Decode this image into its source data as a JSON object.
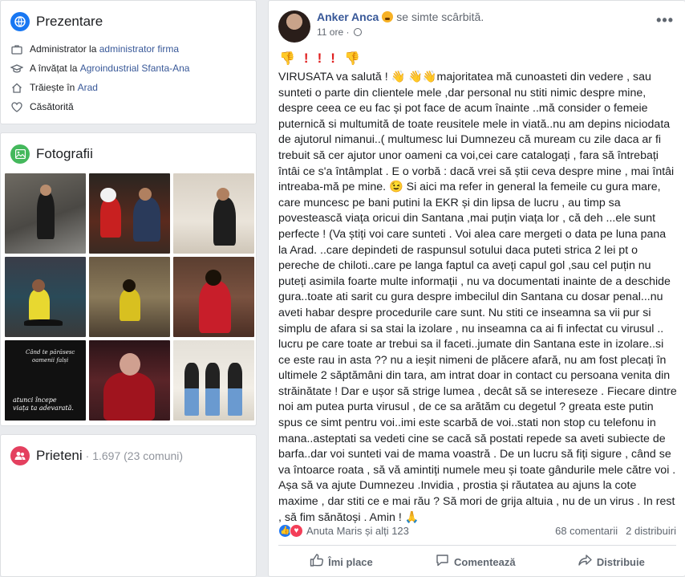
{
  "intro": {
    "title": "Prezentare",
    "items": [
      {
        "icon": "briefcase-icon",
        "prefix": "Administrator la",
        "link": "administrator firma"
      },
      {
        "icon": "graduation-cap-icon",
        "prefix": "A învățat la",
        "link": "Agroindustrial Sfanta-Ana"
      },
      {
        "icon": "home-icon",
        "prefix": "Trăiește în",
        "link": "Arad"
      },
      {
        "icon": "heart-icon",
        "prefix": "Căsătorită",
        "link": ""
      }
    ]
  },
  "photos": {
    "title": "Fotografii",
    "quote_lines": [
      "Când te părăsesc",
      "oamenii falși"
    ],
    "quote_bottom": [
      "atunci începe",
      "viața ta adevarată."
    ]
  },
  "friends": {
    "title": "Prieteni",
    "count": "· 1.697 (23 comuni)"
  },
  "post": {
    "author": "Anker Anca",
    "feeling": "se simte scârbită.",
    "time": "11 ore ·",
    "emoji_row": [
      "👎",
      "!",
      "!",
      "!",
      "👎"
    ],
    "body": "VIRUSATA va salută ! 👋 👋👋majoritatea mă cunoasteti din vedere , sau sunteti o parte din clientele mele ,dar personal nu stiti nimic despre mine, despre ceea ce eu fac și pot face de acum înainte ..mă consider o femeie puternică si multumită de toate reusitele mele in viată..nu am depins niciodata de ajutorul nimanui..( multumesc lui Dumnezeu că muream cu zile daca ar fi trebuit să cer ajutor unor oameni ca voi,cei care catalogați , fara să întrebați întâi ce s'a întâmplat . E o vorbă : dacă vrei să știi ceva despre mine , mai întâi intreaba-mă pe mine. 😉 Si aici ma refer in general la femeile cu gura mare, care muncesc pe bani putini la EKR și din lipsa de lucru , au timp sa povestească viața oricui din Santana ,mai puțin viața lor , că deh ...ele sunt perfecte ! (Va știți voi care sunteti . Voi alea care mergeti o data pe luna pana la Arad. ..care depindeti de raspunsul sotului daca puteti strica 2 lei pt o pereche de chiloti..care pe langa faptul ca aveți capul gol ,sau cel puțin nu puteți asimila foarte multe informații , nu va documentati inainte de a deschide gura..toate ati sarit cu gura despre imbecilul din Santana cu dosar penal...nu aveti habar despre procedurile care sunt. Nu stiti ce inseamna sa vii pur si simplu de afara si sa stai la izolare , nu inseamna ca ai fi infectat cu virusul .. lucru pe care toate ar trebui sa il faceti..jumate din Santana este in izolare..si ce este rau in asta ?? nu a ieșit nimeni de plăcere afară, nu am fost plecați în ultimele 2 săptămâni din tara, am intrat doar in contact cu persoana venita din străinătate ! Dar e ușor să strige lumea , decât să se intereseze . Fiecare dintre noi am putea purta virusul , de ce sa arătăm cu degetul ? greata este putin spus ce simt pentru voi..imi este scarbă de voi..stati non stop cu telefonu in mana..asteptati sa vedeti cine se cacă să postati repede sa aveti subiecte de barfa..dar voi sunteti vai de mama voastră . De un lucru să fiți sigure , când se va întoarce roata , să vă amintiți numele meu și toate gândurile mele către voi . Așa să va ajute Dumnezeu .Invidia , prostia și răutatea au ajuns la cote maxime , dar stiti ce e mai rău ? Să mori de grija altuia , nu de un virus . In rest , să fim sănătoși . Amin ! 🙏",
    "reactions_text": "Anuta Maris și alți 123",
    "comments": "68 comentarii",
    "shares": "2 distribuiri",
    "actions": {
      "like": "Îmi place",
      "comment": "Comentează",
      "share": "Distribuie"
    }
  },
  "colors": {
    "link": "#385898",
    "intro_icon": "#1877f2",
    "photos_icon": "#44b85c",
    "friends_icon": "#e4405f"
  }
}
